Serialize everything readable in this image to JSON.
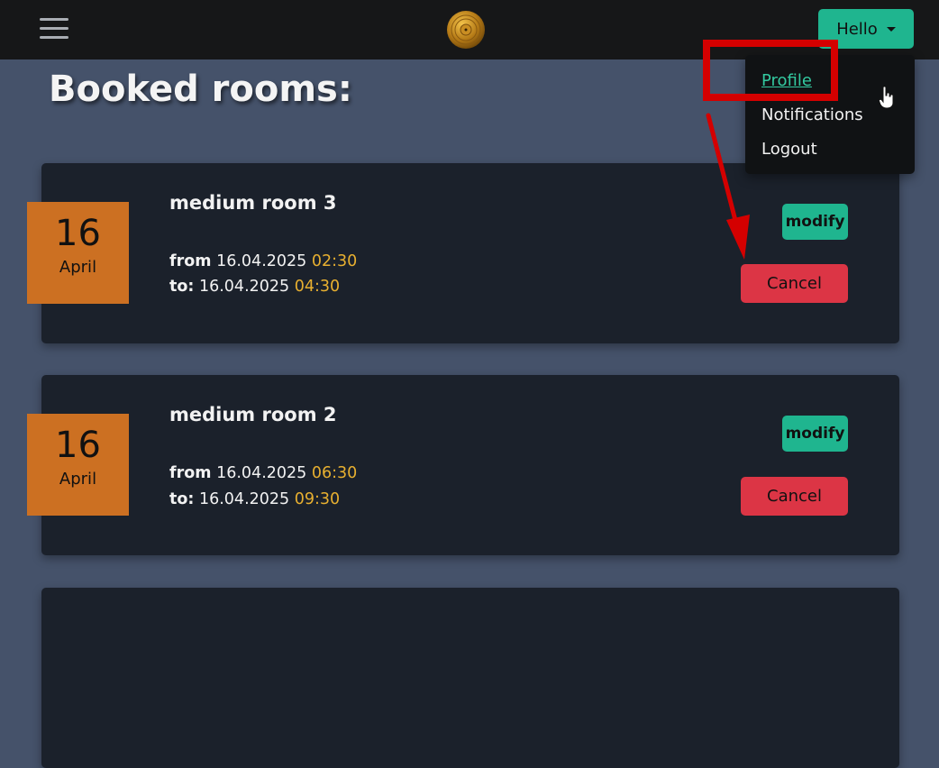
{
  "navbar": {
    "menu_icon": "hamburger-menu-icon",
    "logo_icon": "gold-vinyl-record-icon",
    "user_button_label": "Hello"
  },
  "dropdown": {
    "items": [
      {
        "label": "Profile",
        "active": true
      },
      {
        "label": "Notifications"
      },
      {
        "label": "Logout"
      }
    ]
  },
  "page": {
    "title": "Booked rooms:"
  },
  "bookings": [
    {
      "day": "16",
      "month": "April",
      "room": "medium room 3",
      "from_label": "from",
      "from_date": "16.04.2025",
      "from_time": "02:30",
      "to_label": "to:",
      "to_date": "16.04.2025",
      "to_time": "04:30",
      "modify_label": "modify",
      "cancel_label": "Cancel"
    },
    {
      "day": "16",
      "month": "April",
      "room": "medium room 2",
      "from_label": "from",
      "from_date": "16.04.2025",
      "from_time": "06:30",
      "to_label": "to:",
      "to_date": "16.04.2025",
      "to_time": "09:30",
      "modify_label": "modify",
      "cancel_label": "Cancel"
    }
  ],
  "colors": {
    "background": "#45526a",
    "navbar": "#161718",
    "card": "#1b212b",
    "accent_teal": "#1fb58f",
    "date_orange": "#cc7022",
    "time_yellow": "#e8b030",
    "cancel_red": "#dc3545",
    "annotation_red": "#d40000"
  }
}
